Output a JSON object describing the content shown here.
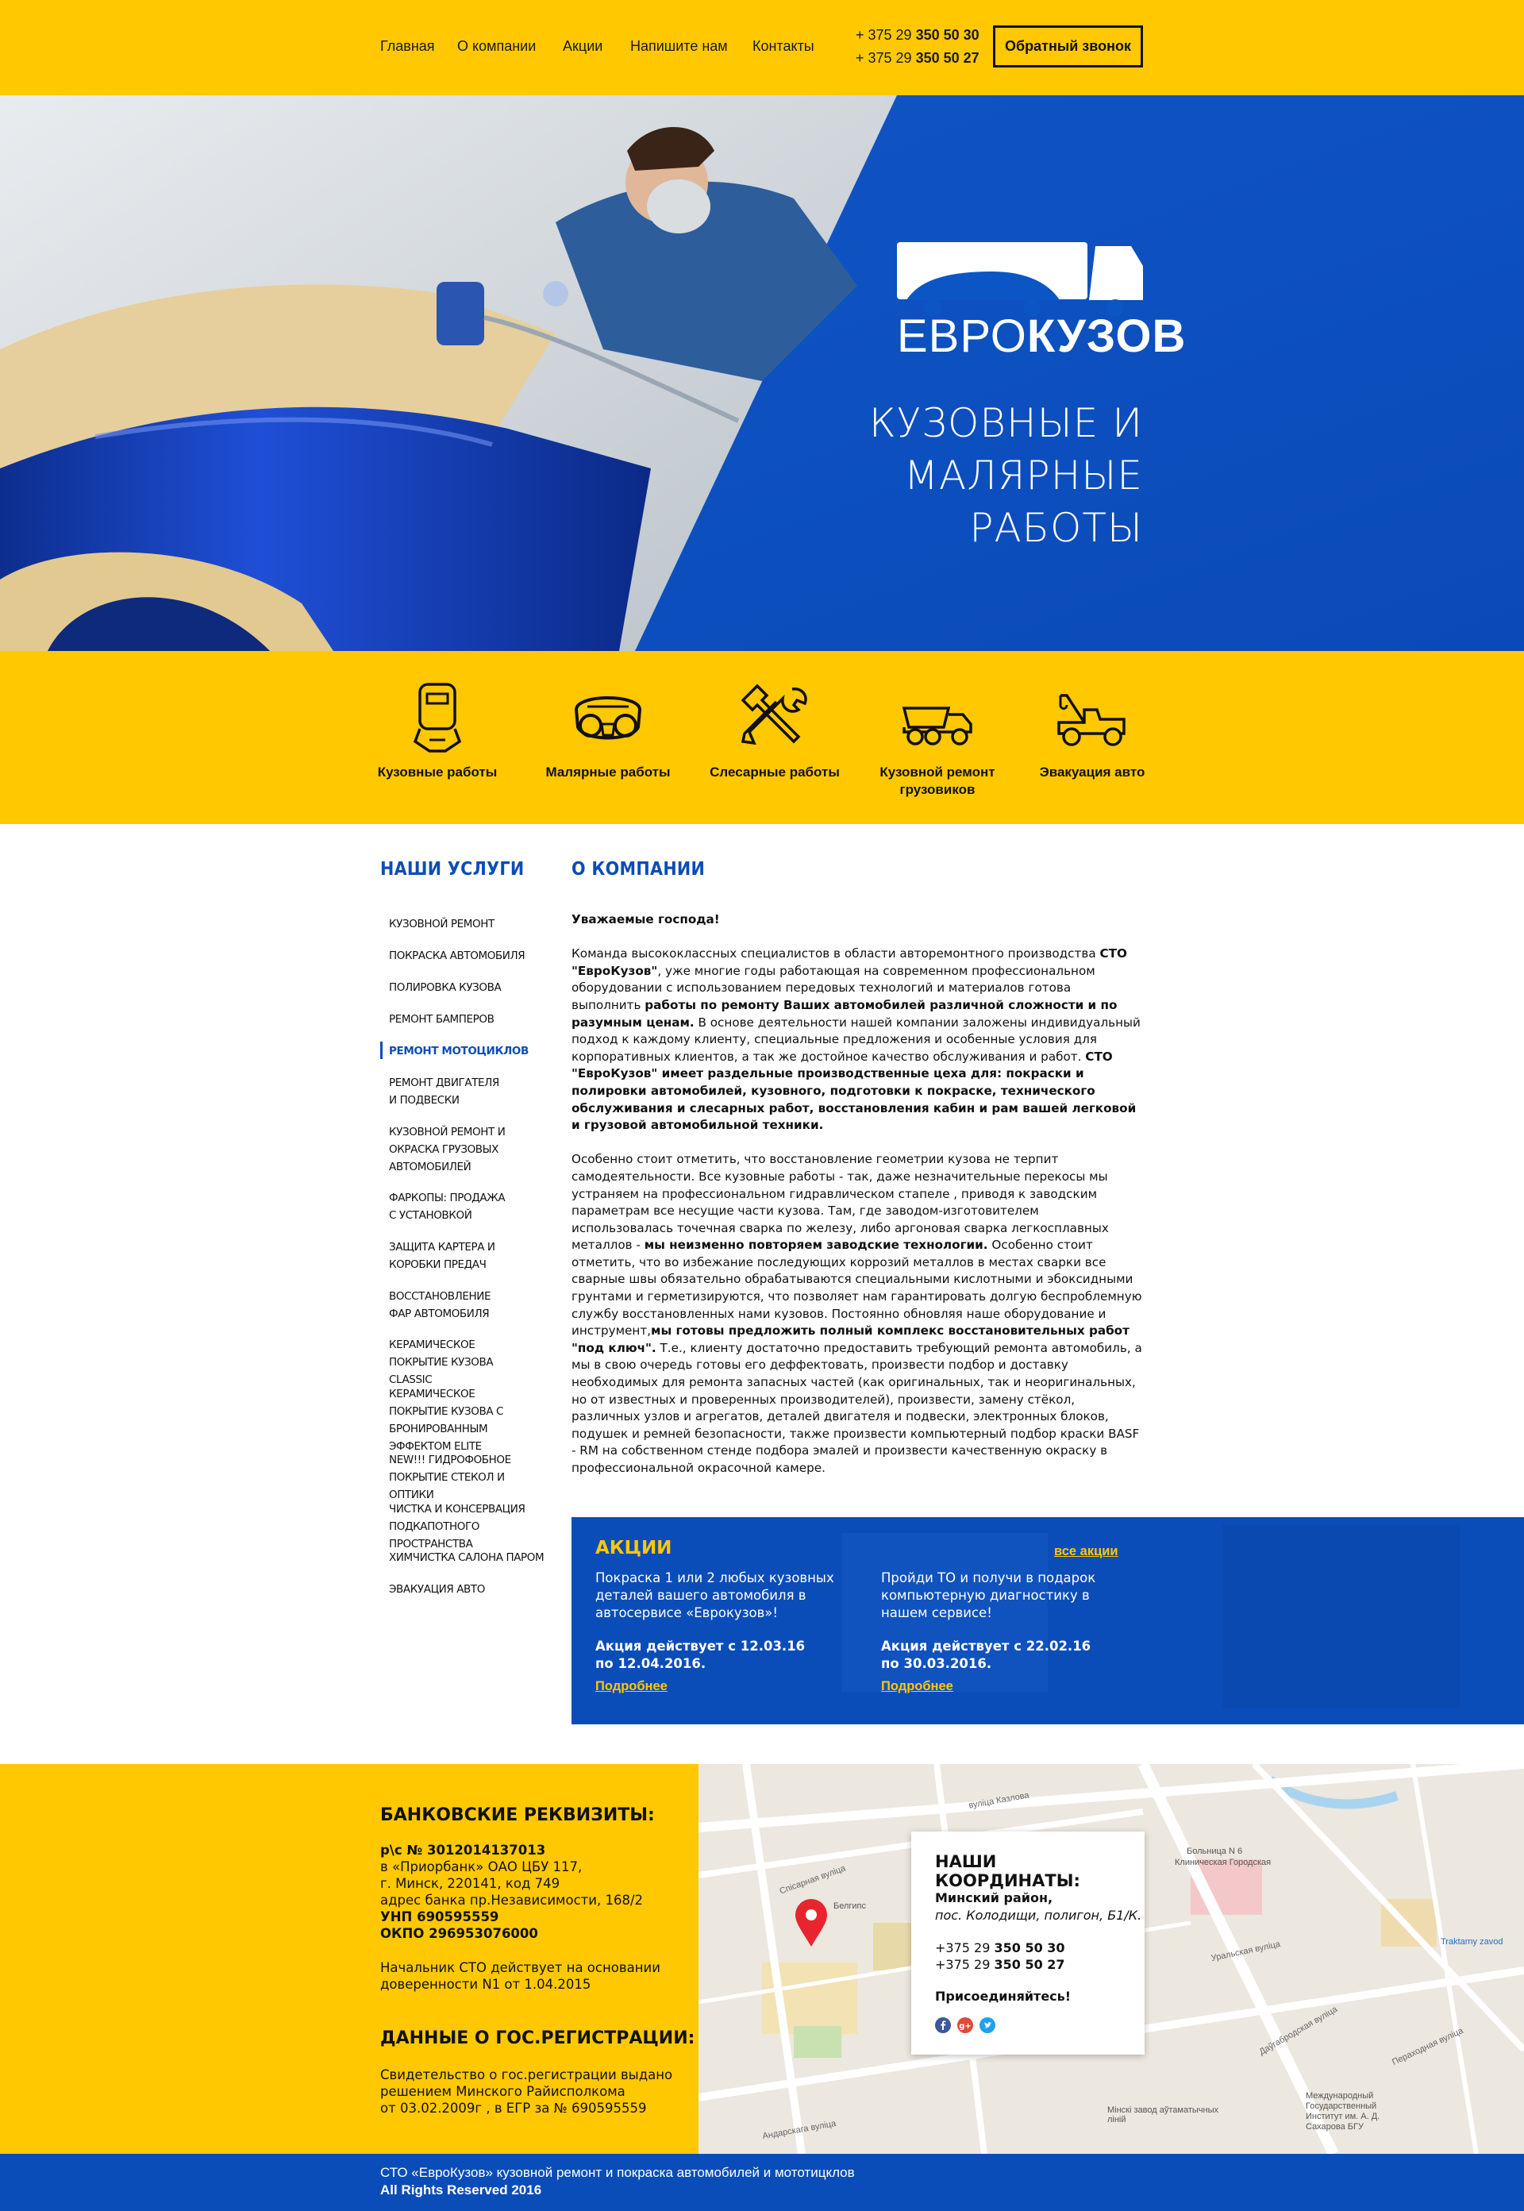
{
  "header": {
    "nav": [
      "Главная",
      "О компании",
      "Акции",
      "Напишите нам",
      "Контакты"
    ],
    "phones": [
      {
        "prefix": "+ 375 29 ",
        "number": "350 50 30"
      },
      {
        "prefix": "+ 375 29 ",
        "number": "350 50 27"
      }
    ],
    "callback_label": "Обратный звонок"
  },
  "hero": {
    "logo_light": "ЕВРО",
    "logo_bold": "КУЗОВ",
    "title_line1": "КУЗОВНЫЕ И",
    "title_line2": "МАЛЯРНЫЕ РАБОТЫ"
  },
  "services": [
    {
      "label": "Кузовные работы",
      "icon": "welding-mask-icon"
    },
    {
      "label": "Малярные работы",
      "icon": "respirator-icon"
    },
    {
      "label": "Слесарные работы",
      "icon": "tools-icon"
    },
    {
      "label": "Кузовной ремонт грузовиков",
      "icon": "dump-truck-icon"
    },
    {
      "label": "Эвакуация авто",
      "icon": "tow-truck-icon"
    }
  ],
  "sidebar": {
    "title": "НАШИ УСЛУГИ",
    "items": [
      "Кузовной ремонт",
      "Покраска автомобиля",
      "Полировка кузова",
      "Ремонт бамперов",
      "Ремонт мотоциклов",
      "Ремонт двигателя и подвески",
      "Кузовной ремонт и окраска грузовых автомобилей",
      "Фаркопы: продажа с установкой",
      "Защита картера и коробки предач",
      "Восстановление фар автомобиля",
      "Керамическое покрытие кузова Classic",
      "Керамическое покрытие кузова с бронированным эффектом Elite",
      "NEW!!! Гидрофобное покрытие стекол и оптики",
      "Чистка и консервация подкапотного пространства",
      "Химчистка салона паром",
      "Эвакуация авто"
    ],
    "active_index": 4
  },
  "about": {
    "title": "О КОМПАНИИ",
    "greeting": "Уважаемые господа!",
    "p1_a": "Команда высококлассных специалистов в области авторемонтного производства ",
    "p1_b": "СТО \"ЕвроКузов\"",
    "p1_c": ", уже многие годы работающая на современном профессиональном оборудовании с использованием передовых технологий и материалов готова выполнить ",
    "p1_d": "работы по ремонту Ваших автомобилей различной сложности и по разумным ценам.",
    "p1_e": " В основе деятельности нашей компании заложены индивидуальный подход к каждому клиенту, специальные предложения и особенные условия для корпоративных клиентов, а так же достойное качество обслуживания и работ. ",
    "p1_f": "СТО \"ЕвроКузов\" имеет раздельные производственные цеха для: покраски и полировки автомобилей, кузовного, подготовки к покраске, технического обслуживания и слесарных работ, восстановления кабин и рам вашей легковой и грузовой автомобильной техники.",
    "p2_a": "Особенно стоит отметить, что восстановление геометрии кузова не терпит самодеятельности. Все кузовные работы - так, даже незначительные перекосы мы устраняем на профессиональном гидравлическом стапеле , приводя  к заводским параметрам все несущие части кузова. Там, где заводом-изготовителем использовалась точечная сварка по железу, либо аргоновая сварка легкосплавных металлов - ",
    "p2_b": "мы неизменно повторяем заводские технологии.",
    "p2_c": " Особенно стоит отметить, что во избежание последующих коррозий металлов в местах сварки все сварные швы обязательно обрабатываются специальными кислотными и эбоксидными грунтами и герметизируются, что позволяет нам гарантировать долгую беспроблемную службу восстановленных нами кузовов. Постоянно обновляя наше оборудование и инструмент,",
    "p2_d": "мы готовы предложить полный комплекс восстановительных работ \"под ключ\".",
    "p2_e": " Т.е., клиенту достаточно предоставить требующий ремонта автомобиль, а мы в свою очередь готовы его деффектовать, произвести подбор и доставку необходимых для ремонта запасных частей (как оригинальных, так и неоригинальных, но от известных и проверенных производителей), произвести, замену стёкол, различных узлов и агрегатов, деталей двигателя и подвески, электронных блоков, подушек и ремней безопасности, также произвести компьютерный подбор краски BASF - RM на собственном стенде подбора эмалей  и произвести качественную окраску в профессиональной окрасочной камере."
  },
  "promo": {
    "title": "АКЦИИ",
    "all_link": "все акции",
    "items": [
      {
        "text": "Покраска 1 или 2 любых кузовных деталей вашего автомобиля в автосервисе «Еврокузов»!",
        "period_line1": "Акция действует с 12.03.16",
        "period_line2": "по 12.04.2016.",
        "more": "Подробнее"
      },
      {
        "text": "Пройди ТО и получи в подарок компьютерную диагностику в нашем сервисе!",
        "period_line1": "Акция действует с 22.02.16",
        "period_line2": "по 30.03.2016.",
        "more": "Подробнее"
      }
    ]
  },
  "bank": {
    "title": "БАНКОВСКИЕ РЕКВИЗИТЫ:",
    "account": "р\\с № 3012014137013",
    "line2": "в  «Приорбанк» ОАО ЦБУ 117,",
    "line3": "г. Минск, 220141, код 749",
    "line4": "адрес банка пр.Независимости, 168/2",
    "unp": "УНП 690595559",
    "okpo": "ОКПО 296953076000",
    "note1": "Начальник СТО действует на основании",
    "note2": "доверенности N1 от 1.04.2015"
  },
  "registration": {
    "title": "ДАННЫЕ О ГОС.РЕГИСТРАЦИИ:",
    "line1": "Свидетельство о гос.регистрации выдано",
    "line2": "решением Минского Райисполкома",
    "line3": "от 03.02.2009г , в ЕГР за  № 690595559"
  },
  "contacts": {
    "title": "НАШИ КООРДИНАТЫ:",
    "region": "Минский район,",
    "address": "пос. Колодищи, полигон, Б1/К.",
    "phones": [
      {
        "prefix": "+375 29 ",
        "number": "350 50 30"
      },
      {
        "prefix": "+375 29 ",
        "number": "350 50 27"
      }
    ],
    "join": "Присоединяйтесь!",
    "socials": [
      "facebook-icon",
      "google-plus-icon",
      "twitter-icon"
    ]
  },
  "map_labels": {
    "l1": "Белгипс",
    "l2": "Больница N 6",
    "l3": "Клиническая Городская",
    "l4": "Traktarny zavod",
    "l5": "Мінскі завод аўтаматычных ліній",
    "l6": "Международный Государственный Институт им. А. Д. Сахарова БГУ",
    "l7": "Уральская вуліца",
    "l8": "Даўгабродская вуліца",
    "l9": "Андарскага вуліца",
    "l10": "вуліца Казлова",
    "l11": "Спісарная вуліца",
    "l12": "Пераходная вуліца"
  },
  "footer_bar": {
    "line1": "СТО «ЕвроКузов» кузовной ремонт и покраска автомобилей и мототицклов",
    "line2": "All Rights Reserved 2016"
  },
  "colors": {
    "yellow": "#ffc800",
    "blue": "#0b4db8",
    "dark": "#111111"
  }
}
